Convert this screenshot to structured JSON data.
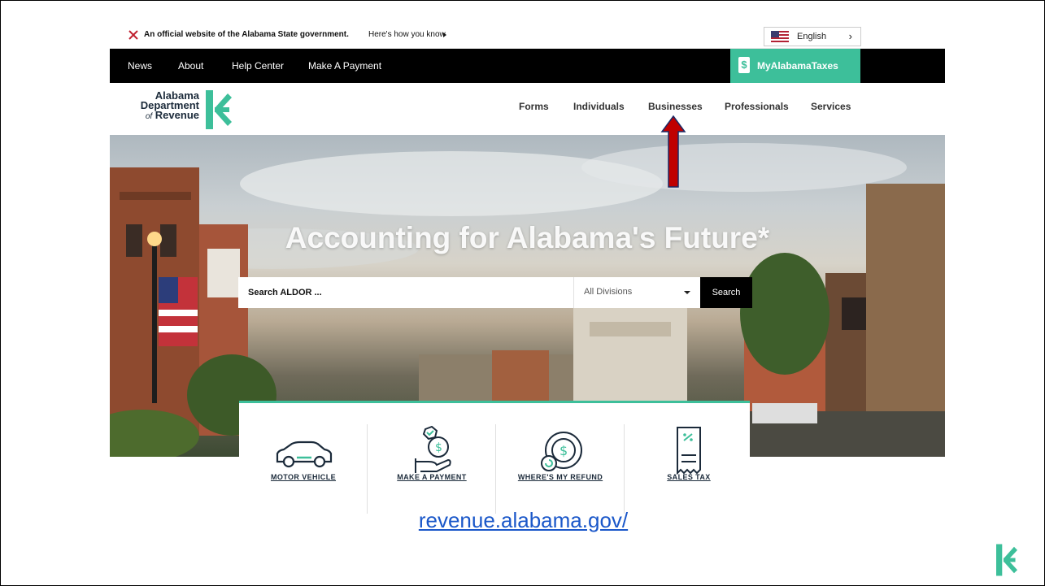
{
  "official_banner": {
    "text": "An official website of the Alabama State government.",
    "link": "Here's how you know",
    "language": "English"
  },
  "top_nav": {
    "items": [
      "News",
      "About",
      "Help Center",
      "Make A Payment"
    ],
    "portal_label": "MyAlabamaTaxes",
    "portal_icon": "dollar-tag-icon"
  },
  "logo": {
    "line1": "Alabama",
    "line2": "Department",
    "line3_prefix": "of",
    "line3": "Revenue"
  },
  "main_nav": {
    "items": [
      "Forms",
      "Individuals",
      "Businesses",
      "Professionals",
      "Services"
    ]
  },
  "hero": {
    "headline": "Accounting for Alabama's Future*",
    "search_placeholder": "Search ALDOR ...",
    "division_selected": "All Divisions",
    "search_button": "Search"
  },
  "quick_links": [
    {
      "label": "MOTOR VEHICLE",
      "icon": "car-icon"
    },
    {
      "label": "MAKE A PAYMENT",
      "icon": "hand-payment-icon"
    },
    {
      "label": "WHERE'S MY REFUND",
      "icon": "refund-coin-icon"
    },
    {
      "label": "SALES TAX",
      "icon": "receipt-icon"
    }
  ],
  "annotation": {
    "arrow_color": "#c00000",
    "target": "Businesses"
  },
  "footer": {
    "url": "revenue.alabama.gov/"
  },
  "colors": {
    "brand_green": "#3dbf9a",
    "nav_black": "#000000",
    "link_blue": "#1a57c9"
  }
}
